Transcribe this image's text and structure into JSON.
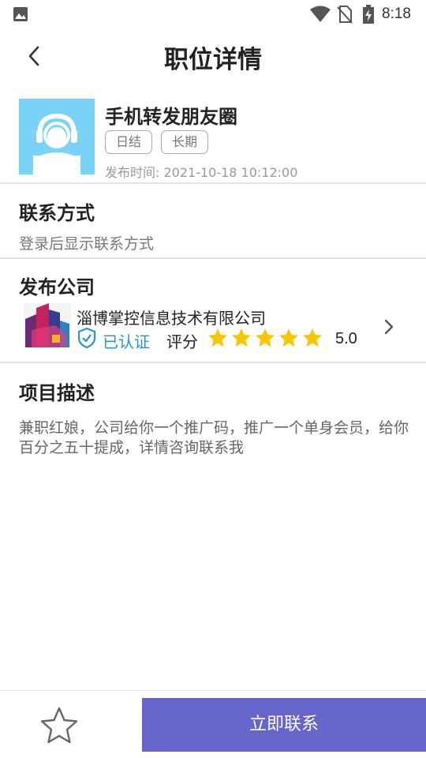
{
  "status_bar": {
    "time": "8:18"
  },
  "header": {
    "title": "职位详情"
  },
  "job": {
    "title": "手机转发朋友圈",
    "tags": [
      "日结",
      "长期"
    ],
    "publish_time": "发布时间: 2021-10-18 10:12:00"
  },
  "contact": {
    "title": "联系方式",
    "text": "登录后显示联系方式"
  },
  "company": {
    "section_title": "发布公司",
    "name": "淄博掌控信息技术有限公司",
    "verified_label": "已认证",
    "rating_label": "评分",
    "rating_value": 5,
    "rating_text": "5.0"
  },
  "description": {
    "title": "项目描述",
    "text": "兼职红娘，公司给你一个推广码，推广一个单身会员，给你百分之五十提成，详情咨询联系我"
  },
  "bottom": {
    "contact_button": "立即联系"
  },
  "colors": {
    "accent": "#6764cc",
    "verified": "#2a92d8",
    "star": "#f7c600",
    "avatar_bg": "#7ad3f7"
  }
}
